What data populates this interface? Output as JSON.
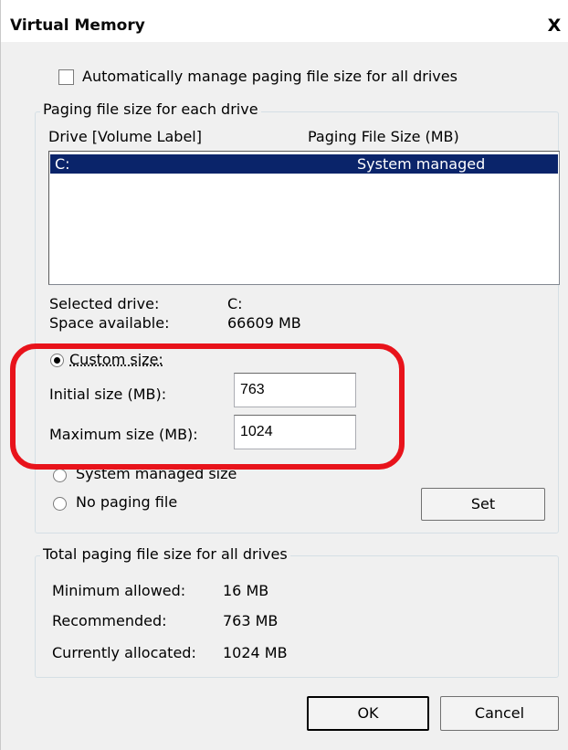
{
  "window": {
    "title": "Virtual Memory",
    "close_label": "X"
  },
  "auto_manage": {
    "label": "Automatically manage paging file size for all drives",
    "checked": false
  },
  "paging_group": {
    "legend": "Paging file size for each drive",
    "col_drive": "Drive  [Volume Label]",
    "col_size": "Paging File Size (MB)",
    "rows": [
      {
        "drive": "C:",
        "size": "System managed",
        "selected": true
      }
    ],
    "selected_drive_label": "Selected drive:",
    "selected_drive_value": "C:",
    "space_label": "Space available:",
    "space_value": "66609 MB",
    "custom_size_label": "Custom size:",
    "initial_label": "Initial size (MB):",
    "initial_value": "763",
    "max_label": "Maximum size (MB):",
    "max_value": "1024",
    "system_managed_label": "System managed size",
    "no_paging_label": "No paging file",
    "set_label": "Set"
  },
  "total_group": {
    "legend": "Total paging file size for all drives",
    "min_label": "Minimum allowed:",
    "min_value": "16 MB",
    "rec_label": "Recommended:",
    "rec_value": "763 MB",
    "alloc_label": "Currently allocated:",
    "alloc_value": "1024 MB"
  },
  "buttons": {
    "ok": "OK",
    "cancel": "Cancel"
  },
  "colors": {
    "selection": "#0a246a",
    "highlight_ring": "#e8131b",
    "dialog_bg": "#f0f0f0"
  }
}
